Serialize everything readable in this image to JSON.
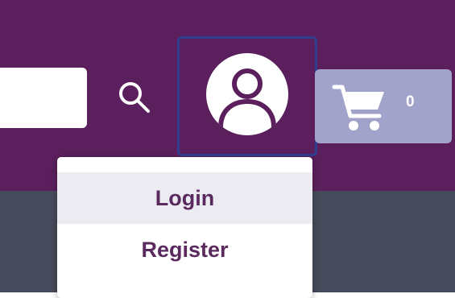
{
  "header": {
    "background_color": "#5a1f5c",
    "search": {
      "value": "",
      "placeholder": ""
    },
    "search_button_icon": "search-icon",
    "user_button_icon": "user-account-icon",
    "cart": {
      "icon": "shopping-cart-icon",
      "count": "0",
      "background_color": "#a2a3cb"
    }
  },
  "subbar": {
    "background_color": "#474a5a"
  },
  "account_menu": {
    "items": [
      {
        "label": "Login",
        "highlighted": true
      },
      {
        "label": "Register",
        "highlighted": false
      }
    ]
  }
}
